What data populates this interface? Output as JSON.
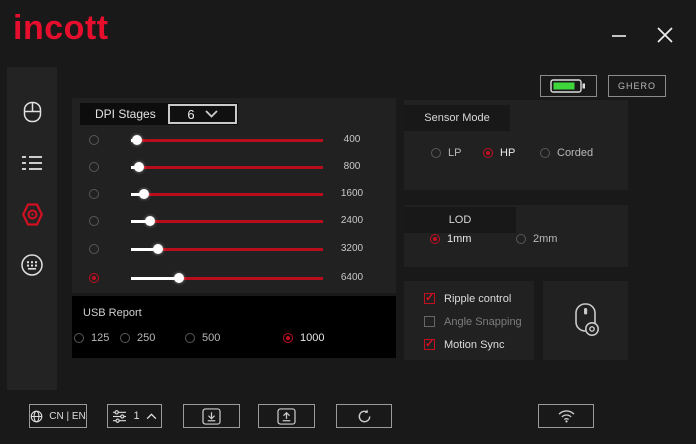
{
  "window": {
    "brand": "incott"
  },
  "titlebar": {
    "battery_level_percent": 85,
    "device_name": "GHERO"
  },
  "sidebar": {
    "items": [
      {
        "icon": "mouse-icon",
        "active": false
      },
      {
        "icon": "list-icon",
        "active": false
      },
      {
        "icon": "sensor-hex-icon",
        "active": true
      },
      {
        "icon": "keyboard-icon",
        "active": false
      }
    ]
  },
  "dpi": {
    "title": "DPI Stages",
    "stage_count": "6",
    "stages": [
      {
        "value": "400",
        "selected": false,
        "fraction": 3
      },
      {
        "value": "800",
        "selected": false,
        "fraction": 4
      },
      {
        "value": "1600",
        "selected": false,
        "fraction": 7
      },
      {
        "value": "2400",
        "selected": false,
        "fraction": 10
      },
      {
        "value": "3200",
        "selected": false,
        "fraction": 14
      },
      {
        "value": "6400",
        "selected": true,
        "fraction": 25
      }
    ]
  },
  "usb_report": {
    "title": "USB Report",
    "options": [
      {
        "label": "125",
        "selected": false
      },
      {
        "label": "250",
        "selected": false
      },
      {
        "label": "500",
        "selected": false
      },
      {
        "label": "1000",
        "selected": true
      }
    ]
  },
  "sensor_mode": {
    "title": "Sensor Mode",
    "options": [
      {
        "label": "LP",
        "selected": false
      },
      {
        "label": "HP",
        "selected": true
      },
      {
        "label": "Corded",
        "selected": false
      }
    ]
  },
  "lod": {
    "title": "LOD",
    "options": [
      {
        "label": "1mm",
        "selected": true
      },
      {
        "label": "2mm",
        "selected": false
      }
    ]
  },
  "sensor_toggles": [
    {
      "label": "Ripple control",
      "checked": true
    },
    {
      "label": "Angle Snapping",
      "checked": false
    },
    {
      "label": "Motion Sync",
      "checked": true
    }
  ],
  "footer": {
    "language": "CN | EN",
    "profile": "1"
  },
  "colors": {
    "accent_red": "#d40e23",
    "slider_red": "#b80e1b",
    "battery_green": "#3ed63a",
    "background": "#191919",
    "panel": "#212121",
    "usb_panel": "#000000"
  }
}
